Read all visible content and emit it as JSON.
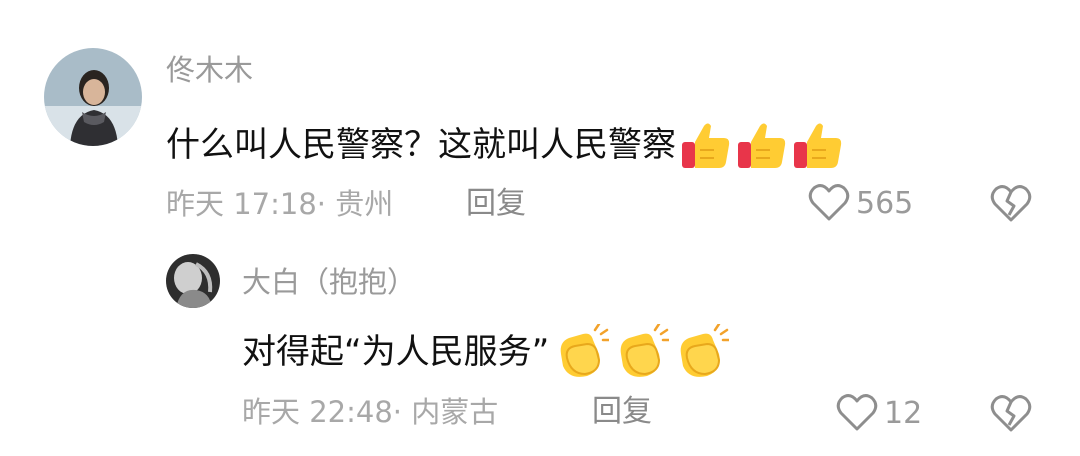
{
  "comments": [
    {
      "author": "佟木木",
      "text": "什么叫人民警察？这就叫人民警察",
      "emojis": [
        "thumbs-up-icon",
        "thumbs-up-icon",
        "thumbs-up-icon"
      ],
      "time": "昨天 17:18",
      "location": "· 贵州",
      "reply_label": "回复",
      "likes": "565"
    },
    {
      "author": "大白（抱抱）",
      "text": "对得起“为人民服务”",
      "emojis": [
        "clapping-hands-icon",
        "clapping-hands-icon",
        "clapping-hands-icon"
      ],
      "time": "昨天 22:48",
      "location": "· 内蒙古",
      "reply_label": "回复",
      "likes": "12"
    }
  ],
  "colors": {
    "text": "#111111",
    "muted": "#9a9a9a",
    "emoji_yellow": "#ffcc33",
    "emoji_red": "#e8354a"
  }
}
